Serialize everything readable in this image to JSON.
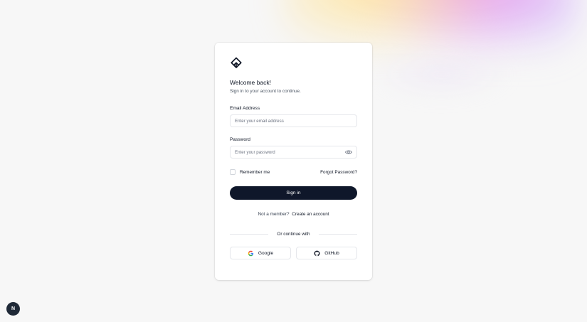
{
  "login": {
    "title": "Welcome back!",
    "subtitle": "Sign in to your account to continue.",
    "email_label": "Email Address",
    "email_placeholder": "Enter your email address",
    "email_value": "",
    "password_label": "Password",
    "password_placeholder": "Enter your password",
    "password_value": "",
    "remember_label": "Remember me",
    "forgot_label": "Forgot Password?",
    "signin_label": "Sign in",
    "member_text": "Not a member?",
    "create_account_label": "Create an account",
    "divider_text": "Or continue with",
    "google_label": "Google",
    "github_label": "GitHub"
  },
  "badge": {
    "letter": "N"
  },
  "icons": {
    "logo": "app-logo-icon",
    "eye": "eye-icon",
    "google": "google-icon",
    "github": "github-icon"
  },
  "colors": {
    "primary": "#0f172a",
    "border": "#e5e7eb",
    "card_bg": "#ffffff",
    "page_bg": "#f7f7f7"
  }
}
